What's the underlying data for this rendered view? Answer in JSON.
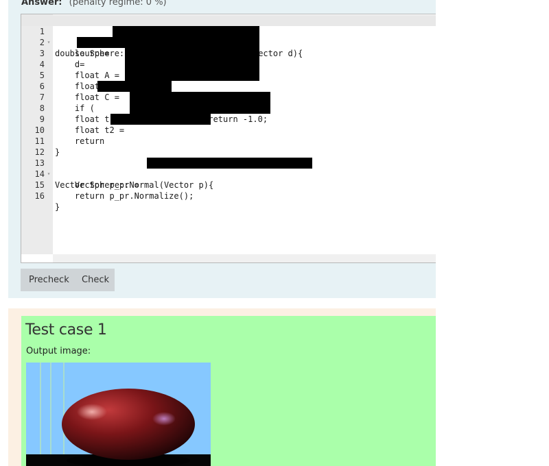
{
  "answer": {
    "label": "Answer:",
    "penalty": "(penalty regime: 0 %)"
  },
  "editor": {
    "lines": [
      {
        "num": "1",
        "fold": "▾",
        "text": "double Sphere::Intersect(Vector source, Vector d){"
      },
      {
        "num": "2",
        "fold": "",
        "text": "    source="
      },
      {
        "num": "3",
        "fold": "",
        "text": "    d="
      },
      {
        "num": "4",
        "fold": "",
        "text": "    float A ="
      },
      {
        "num": "5",
        "fold": "",
        "text": "    float B ="
      },
      {
        "num": "6",
        "fold": "",
        "text": "    float C ="
      },
      {
        "num": "7",
        "fold": "",
        "text": "    if ("
      },
      {
        "num": "8",
        "fold": "",
        "text": "    float t1 ="
      },
      {
        "num": "9",
        "fold": "",
        "text": "    float t2 ="
      },
      {
        "num": "10",
        "fold": "",
        "text": "    return"
      },
      {
        "num": "11",
        "fold": "",
        "text": "}"
      },
      {
        "num": "12",
        "fold": "",
        "text": ""
      },
      {
        "num": "13",
        "fold": "▾",
        "text": "Vector Sphere::Normal(Vector p){"
      },
      {
        "num": "14",
        "fold": "",
        "text": "    Vector p_pr ="
      },
      {
        "num": "15",
        "fold": "",
        "text": "    return p_pr.Normalize();"
      },
      {
        "num": "16",
        "fold": "",
        "text": "}"
      }
    ],
    "line7_tail": "<= 0) return -1.0;"
  },
  "buttons": {
    "precheck": "Precheck",
    "check": "Check"
  },
  "test_case": {
    "title": "Test case 1",
    "output_label": "Output image:"
  },
  "colors": {
    "answer_bg": "#e7f2f5",
    "pass_bg": "#aaffaa",
    "test_outer_bg": "#fcf0e3",
    "render_sky": "#86c8ff",
    "sphere": "#7a1518"
  }
}
